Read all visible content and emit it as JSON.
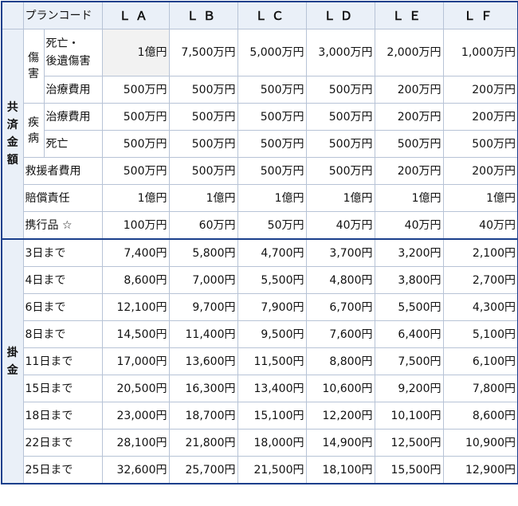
{
  "table": {
    "corner_label": "プランコード",
    "plans": [
      "ＬＡ",
      "ＬＢ",
      "ＬＣ",
      "ＬＤ",
      "ＬＥ",
      "ＬＦ"
    ],
    "kyosai": {
      "section_label": [
        "共",
        "済",
        "金",
        "額"
      ],
      "shogai_group": [
        "傷",
        "害"
      ],
      "shippei_group": [
        "疾",
        "病"
      ],
      "rows": [
        {
          "label": [
            "死亡・",
            "後遺傷害"
          ],
          "values": [
            "1億円",
            "7,500万円",
            "5,000万円",
            "3,000万円",
            "2,000万円",
            "1,000万円"
          ]
        },
        {
          "label": "治療費用",
          "values": [
            "500万円",
            "500万円",
            "500万円",
            "500万円",
            "200万円",
            "200万円"
          ]
        },
        {
          "label": "治療費用",
          "values": [
            "500万円",
            "500万円",
            "500万円",
            "500万円",
            "200万円",
            "200万円"
          ]
        },
        {
          "label": "死亡",
          "values": [
            "500万円",
            "500万円",
            "500万円",
            "500万円",
            "500万円",
            "500万円"
          ]
        },
        {
          "label": "救援者費用",
          "values": [
            "500万円",
            "500万円",
            "500万円",
            "500万円",
            "200万円",
            "200万円"
          ]
        },
        {
          "label": "賠償責任",
          "values": [
            "1億円",
            "1億円",
            "1億円",
            "1億円",
            "1億円",
            "1億円"
          ]
        },
        {
          "label": "携行品 ☆",
          "values": [
            "100万円",
            "60万円",
            "50万円",
            "40万円",
            "40万円",
            "40万円"
          ]
        }
      ]
    },
    "kakekin": {
      "section_label": [
        "掛",
        "金"
      ],
      "rows": [
        {
          "label": "3日まで",
          "values": [
            "7,400円",
            "5,800円",
            "4,700円",
            "3,700円",
            "3,200円",
            "2,100円"
          ]
        },
        {
          "label": "4日まで",
          "values": [
            "8,600円",
            "7,000円",
            "5,500円",
            "4,800円",
            "3,800円",
            "2,700円"
          ]
        },
        {
          "label": "6日まで",
          "values": [
            "12,100円",
            "9,700円",
            "7,900円",
            "6,700円",
            "5,500円",
            "4,300円"
          ]
        },
        {
          "label": "8日まで",
          "values": [
            "14,500円",
            "11,400円",
            "9,500円",
            "7,600円",
            "6,400円",
            "5,100円"
          ]
        },
        {
          "label": "11日まで",
          "values": [
            "17,000円",
            "13,600円",
            "11,500円",
            "8,800円",
            "7,500円",
            "6,100円"
          ]
        },
        {
          "label": "15日まで",
          "values": [
            "20,500円",
            "16,300円",
            "13,400円",
            "10,600円",
            "9,200円",
            "7,800円"
          ]
        },
        {
          "label": "18日まで",
          "values": [
            "23,000円",
            "18,700円",
            "15,100円",
            "12,200円",
            "10,100円",
            "8,600円"
          ]
        },
        {
          "label": "22日まで",
          "values": [
            "28,100円",
            "21,800円",
            "18,000円",
            "14,900円",
            "12,500円",
            "10,900円"
          ]
        },
        {
          "label": "25日まで",
          "values": [
            "32,600円",
            "25,700円",
            "21,500円",
            "18,100円",
            "15,500円",
            "12,900円"
          ]
        }
      ]
    }
  }
}
